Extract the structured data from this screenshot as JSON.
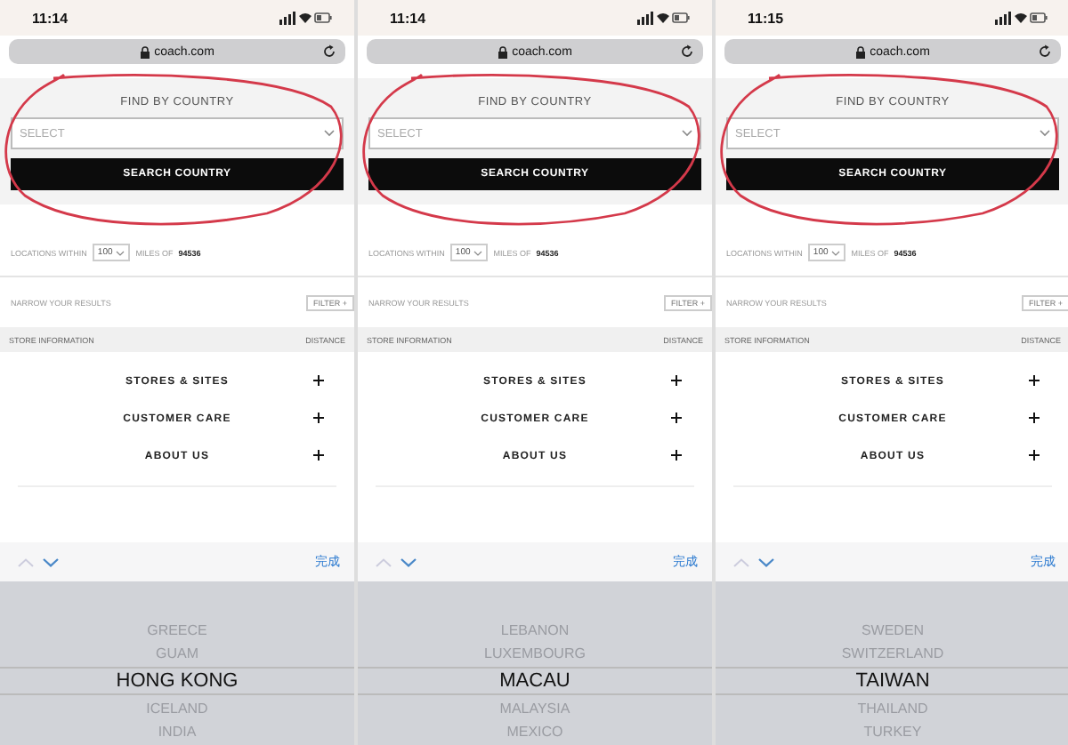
{
  "panels": [
    {
      "time": "11:14",
      "url": "coach.com",
      "find_title": "FIND BY COUNTRY",
      "select_placeholder": "SELECT",
      "search_button": "SEARCH COUNTRY",
      "locations_label": "LOCATIONS WITHIN",
      "radius": "100",
      "miles_label": "MILES OF",
      "zip": "94536",
      "narrow_label": "NARROW YOUR RESULTS",
      "filter_label": "FILTER +",
      "store_info_label": "STORE INFORMATION",
      "distance_label": "DISTANCE",
      "links": [
        "STORES & SITES",
        "CUSTOMER CARE",
        "ABOUT US"
      ],
      "done_label": "完成",
      "picker": [
        {
          "label": "GREECE",
          "selected": false
        },
        {
          "label": "GUAM",
          "selected": false
        },
        {
          "label": "HONG KONG",
          "selected": true
        },
        {
          "label": "ICELAND",
          "selected": false
        },
        {
          "label": "INDIA",
          "selected": false
        }
      ]
    },
    {
      "time": "11:14",
      "url": "coach.com",
      "find_title": "FIND BY COUNTRY",
      "select_placeholder": "SELECT",
      "search_button": "SEARCH COUNTRY",
      "locations_label": "LOCATIONS WITHIN",
      "radius": "100",
      "miles_label": "MILES OF",
      "zip": "94536",
      "narrow_label": "NARROW YOUR RESULTS",
      "filter_label": "FILTER +",
      "store_info_label": "STORE INFORMATION",
      "distance_label": "DISTANCE",
      "links": [
        "STORES & SITES",
        "CUSTOMER CARE",
        "ABOUT US"
      ],
      "done_label": "完成",
      "picker": [
        {
          "label": "LEBANON",
          "selected": false
        },
        {
          "label": "LUXEMBOURG",
          "selected": false
        },
        {
          "label": "MACAU",
          "selected": true
        },
        {
          "label": "MALAYSIA",
          "selected": false
        },
        {
          "label": "MEXICO",
          "selected": false
        }
      ]
    },
    {
      "time": "11:15",
      "url": "coach.com",
      "find_title": "FIND BY COUNTRY",
      "select_placeholder": "SELECT",
      "search_button": "SEARCH COUNTRY",
      "locations_label": "LOCATIONS WITHIN",
      "radius": "100",
      "miles_label": "MILES OF",
      "zip": "94536",
      "narrow_label": "NARROW YOUR RESULTS",
      "filter_label": "FILTER +",
      "store_info_label": "STORE INFORMATION",
      "distance_label": "DISTANCE",
      "links": [
        "STORES & SITES",
        "CUSTOMER CARE",
        "ABOUT US"
      ],
      "done_label": "完成",
      "picker": [
        {
          "label": "SWEDEN",
          "selected": false
        },
        {
          "label": "SWITZERLAND",
          "selected": false
        },
        {
          "label": "TAIWAN",
          "selected": true
        },
        {
          "label": "THAILAND",
          "selected": false
        },
        {
          "label": "TURKEY",
          "selected": false
        }
      ]
    }
  ]
}
